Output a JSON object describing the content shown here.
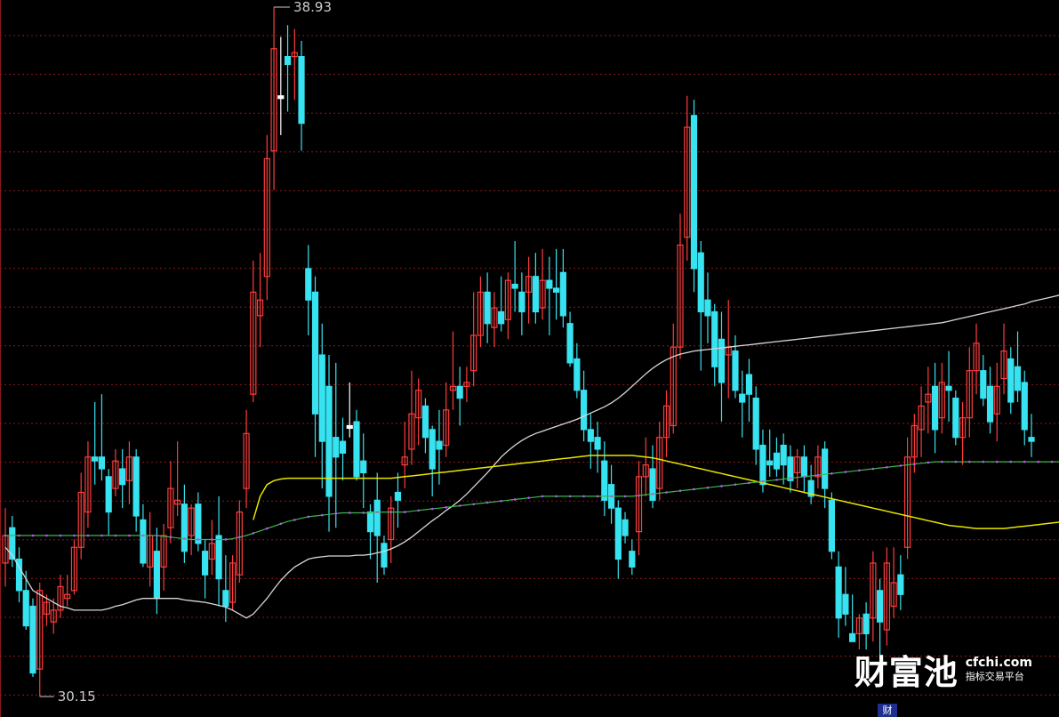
{
  "chart_data": {
    "type": "candlestick",
    "price_high_label": "38.93",
    "price_low_label": "30.15",
    "ylim": [
      29.8,
      39.2
    ],
    "grid": "horizontal dashed red",
    "colors": {
      "up": "#ff3c3c",
      "down": "#37e3f0",
      "doji": "#ffffff",
      "ma_white": "#d8d8d8",
      "ma_yellow": "#e6e600",
      "ma_green": "#39b84a",
      "ma_magenta": "#c050ff",
      "grid": "#8a1a1a"
    },
    "candles": [
      [
        31.85,
        32.55,
        31.55,
        32.2
      ],
      [
        32.3,
        32.45,
        31.8,
        31.9
      ],
      [
        31.9,
        32.05,
        31.35,
        31.5
      ],
      [
        31.5,
        31.75,
        31.0,
        31.05
      ],
      [
        31.3,
        31.4,
        30.4,
        30.45
      ],
      [
        30.5,
        31.6,
        30.15,
        31.5
      ],
      [
        31.2,
        31.45,
        31.05,
        31.35
      ],
      [
        31.1,
        31.4,
        30.95,
        31.25
      ],
      [
        31.25,
        31.7,
        31.15,
        31.55
      ],
      [
        31.4,
        31.7,
        31.3,
        31.45
      ],
      [
        31.5,
        32.15,
        31.45,
        32.05
      ],
      [
        32.05,
        33.0,
        31.9,
        32.75
      ],
      [
        32.5,
        33.4,
        32.3,
        33.2
      ],
      [
        33.2,
        33.9,
        32.85,
        33.15
      ],
      [
        33.2,
        34.0,
        32.9,
        33.05
      ],
      [
        32.95,
        33.05,
        32.2,
        32.5
      ],
      [
        32.8,
        33.3,
        32.7,
        33.15
      ],
      [
        33.05,
        33.3,
        32.55,
        32.85
      ],
      [
        32.9,
        33.4,
        32.6,
        33.2
      ],
      [
        33.2,
        33.3,
        32.25,
        32.45
      ],
      [
        32.4,
        32.6,
        31.8,
        31.85
      ],
      [
        31.8,
        32.5,
        31.55,
        32.2
      ],
      [
        32.0,
        32.3,
        31.2,
        31.4
      ],
      [
        31.8,
        32.35,
        31.5,
        32.2
      ],
      [
        32.3,
        33.15,
        32.1,
        32.8
      ],
      [
        32.6,
        33.4,
        32.45,
        32.65
      ],
      [
        32.6,
        32.85,
        31.85,
        32.0
      ],
      [
        32.2,
        32.6,
        31.95,
        32.55
      ],
      [
        32.6,
        32.75,
        32.0,
        32.1
      ],
      [
        32.0,
        32.15,
        31.4,
        31.7
      ],
      [
        31.9,
        32.4,
        31.7,
        32.1
      ],
      [
        32.2,
        32.7,
        31.3,
        31.65
      ],
      [
        31.5,
        31.95,
        31.1,
        31.3
      ],
      [
        31.35,
        31.95,
        31.25,
        31.85
      ],
      [
        31.7,
        32.65,
        31.6,
        32.5
      ],
      [
        32.8,
        33.8,
        32.55,
        33.5
      ],
      [
        34.0,
        35.7,
        33.9,
        35.3
      ],
      [
        35.0,
        35.8,
        34.6,
        35.2
      ],
      [
        35.5,
        37.3,
        35.2,
        37.0
      ],
      [
        37.1,
        38.93,
        36.6,
        38.4
      ],
      [
        37.8,
        38.55,
        37.3,
        37.8
      ],
      [
        38.3,
        38.7,
        37.6,
        38.2
      ],
      [
        38.3,
        38.65,
        37.75,
        38.35
      ],
      [
        38.3,
        38.5,
        37.1,
        37.45
      ],
      [
        35.6,
        35.9,
        34.75,
        35.2
      ],
      [
        35.3,
        35.5,
        33.2,
        33.75
      ],
      [
        34.5,
        34.9,
        32.8,
        33.4
      ],
      [
        34.1,
        34.5,
        32.25,
        32.7
      ],
      [
        33.45,
        34.4,
        32.3,
        33.2
      ],
      [
        33.4,
        33.7,
        32.9,
        33.25
      ],
      [
        33.6,
        34.15,
        33.45,
        33.6
      ],
      [
        33.65,
        33.8,
        32.9,
        32.95
      ],
      [
        33.15,
        33.5,
        32.55,
        33.0
      ],
      [
        32.5,
        32.6,
        31.9,
        32.25
      ],
      [
        32.65,
        33.0,
        31.6,
        32.2
      ],
      [
        32.1,
        32.2,
        31.7,
        31.8
      ],
      [
        32.15,
        32.7,
        31.85,
        32.55
      ],
      [
        32.75,
        33.0,
        32.3,
        32.65
      ],
      [
        33.1,
        33.65,
        32.8,
        33.2
      ],
      [
        33.3,
        34.3,
        33.1,
        33.75
      ],
      [
        33.7,
        34.2,
        33.35,
        34.05
      ],
      [
        33.85,
        33.95,
        33.25,
        33.45
      ],
      [
        33.55,
        33.6,
        32.7,
        33.05
      ],
      [
        33.4,
        33.8,
        32.85,
        33.3
      ],
      [
        33.35,
        34.15,
        33.2,
        33.8
      ],
      [
        34.05,
        34.8,
        33.8,
        34.1
      ],
      [
        34.1,
        34.35,
        33.6,
        33.95
      ],
      [
        34.1,
        34.35,
        33.9,
        34.15
      ],
      [
        34.3,
        35.3,
        34.1,
        34.75
      ],
      [
        34.75,
        35.5,
        34.6,
        35.3
      ],
      [
        35.3,
        35.55,
        34.65,
        34.9
      ],
      [
        34.85,
        35.3,
        34.6,
        35.1
      ],
      [
        35.05,
        35.5,
        34.8,
        34.9
      ],
      [
        34.95,
        35.55,
        34.7,
        35.45
      ],
      [
        35.4,
        35.95,
        35.05,
        35.35
      ],
      [
        35.3,
        35.55,
        34.75,
        35.05
      ],
      [
        35.3,
        35.75,
        34.9,
        35.5
      ],
      [
        35.5,
        35.8,
        34.9,
        35.05
      ],
      [
        35.1,
        35.85,
        34.95,
        35.45
      ],
      [
        35.45,
        35.75,
        34.75,
        35.35
      ],
      [
        35.35,
        35.85,
        34.95,
        35.3
      ],
      [
        35.55,
        35.85,
        34.85,
        35.0
      ],
      [
        34.9,
        35.05,
        34.35,
        34.4
      ],
      [
        34.45,
        34.65,
        33.95,
        34.05
      ],
      [
        34.05,
        34.3,
        33.4,
        33.55
      ],
      [
        33.55,
        33.75,
        33.05,
        33.4
      ],
      [
        33.45,
        33.65,
        33.0,
        33.3
      ],
      [
        33.15,
        33.4,
        32.45,
        32.65
      ],
      [
        32.85,
        33.1,
        32.35,
        32.55
      ],
      [
        32.55,
        32.65,
        31.65,
        31.9
      ],
      [
        32.4,
        32.5,
        32.1,
        32.2
      ],
      [
        32.0,
        32.15,
        31.7,
        31.8
      ],
      [
        32.25,
        33.15,
        31.95,
        32.95
      ],
      [
        32.95,
        33.45,
        32.7,
        33.1
      ],
      [
        33.05,
        33.35,
        32.55,
        32.65
      ],
      [
        32.8,
        33.65,
        32.65,
        33.45
      ],
      [
        33.45,
        34.05,
        33.2,
        33.85
      ],
      [
        33.6,
        34.9,
        33.5,
        34.6
      ],
      [
        34.6,
        36.3,
        34.45,
        35.9
      ],
      [
        36.0,
        37.8,
        35.7,
        37.4
      ],
      [
        37.55,
        37.75,
        35.3,
        35.6
      ],
      [
        35.8,
        35.95,
        34.3,
        35.05
      ],
      [
        35.2,
        35.55,
        34.65,
        35.0
      ],
      [
        35.05,
        35.15,
        34.1,
        34.35
      ],
      [
        34.7,
        35.05,
        33.65,
        34.15
      ],
      [
        34.5,
        35.2,
        33.95,
        34.6
      ],
      [
        34.55,
        34.75,
        33.95,
        34.05
      ],
      [
        34.0,
        34.3,
        33.45,
        33.9
      ],
      [
        34.25,
        34.45,
        33.65,
        34.0
      ],
      [
        33.95,
        34.1,
        33.1,
        33.3
      ],
      [
        33.35,
        33.55,
        32.75,
        32.85
      ],
      [
        33.15,
        33.55,
        32.95,
        33.1
      ],
      [
        33.25,
        33.45,
        32.95,
        33.05
      ],
      [
        33.35,
        33.5,
        32.85,
        33.1
      ],
      [
        33.2,
        33.35,
        32.75,
        32.9
      ],
      [
        33.0,
        33.3,
        32.8,
        33.2
      ],
      [
        33.2,
        33.35,
        32.75,
        32.95
      ],
      [
        32.9,
        33.1,
        32.6,
        32.7
      ],
      [
        32.95,
        33.35,
        32.8,
        33.2
      ],
      [
        33.3,
        33.4,
        32.55,
        32.8
      ],
      [
        32.65,
        32.75,
        31.9,
        32.0
      ],
      [
        31.8,
        32.0,
        30.9,
        31.15
      ],
      [
        31.45,
        31.8,
        31.05,
        31.2
      ],
      [
        30.95,
        31.45,
        30.9,
        30.85
      ],
      [
        30.95,
        31.2,
        30.75,
        31.15
      ],
      [
        31.2,
        31.35,
        30.75,
        30.95
      ],
      [
        31.15,
        32.0,
        30.85,
        31.85
      ],
      [
        31.5,
        31.65,
        30.65,
        31.1
      ],
      [
        31.0,
        32.05,
        30.8,
        31.85
      ],
      [
        31.3,
        32.05,
        31.15,
        31.6
      ],
      [
        31.7,
        31.95,
        31.25,
        31.45
      ],
      [
        32.05,
        33.45,
        31.9,
        33.2
      ],
      [
        33.2,
        33.75,
        33.0,
        33.6
      ],
      [
        33.55,
        34.1,
        33.2,
        33.85
      ],
      [
        33.9,
        34.35,
        33.5,
        34.0
      ],
      [
        34.1,
        34.4,
        33.25,
        33.55
      ],
      [
        33.7,
        34.4,
        33.5,
        34.15
      ],
      [
        34.1,
        34.55,
        33.65,
        34.05
      ],
      [
        33.95,
        34.05,
        33.35,
        33.45
      ],
      [
        33.45,
        33.9,
        33.1,
        33.7
      ],
      [
        33.7,
        34.6,
        33.45,
        34.3
      ],
      [
        34.3,
        34.9,
        34.0,
        34.65
      ],
      [
        34.3,
        34.5,
        33.85,
        33.95
      ],
      [
        34.1,
        34.35,
        33.5,
        33.65
      ],
      [
        33.75,
        34.4,
        33.4,
        34.1
      ],
      [
        34.2,
        34.9,
        34.0,
        34.55
      ],
      [
        34.45,
        34.6,
        33.75,
        33.9
      ],
      [
        34.35,
        34.8,
        33.9,
        34.05
      ],
      [
        34.15,
        34.3,
        33.35,
        33.55
      ],
      [
        33.45,
        33.75,
        33.2,
        33.4
      ]
    ],
    "ma_white": [
      32.05,
      31.95,
      31.8,
      31.65,
      31.5,
      31.45,
      31.4,
      31.35,
      31.3,
      31.28,
      31.25,
      31.25,
      31.25,
      31.25,
      31.25,
      31.27,
      31.3,
      31.32,
      31.35,
      31.38,
      31.4,
      31.4,
      31.4,
      31.4,
      31.4,
      31.4,
      31.38,
      31.37,
      31.36,
      31.35,
      31.33,
      31.31,
      31.29,
      31.25,
      31.2,
      31.15,
      31.2,
      31.3,
      31.4,
      31.52,
      31.63,
      31.72,
      31.8,
      31.85,
      31.9,
      31.92,
      31.93,
      31.94,
      31.94,
      31.94,
      31.94,
      31.95,
      31.95,
      31.96,
      31.98,
      32.0,
      32.03,
      32.07,
      32.12,
      32.18,
      32.25,
      32.32,
      32.39,
      32.45,
      32.52,
      32.58,
      32.65,
      32.73,
      32.82,
      32.91,
      33.0,
      33.1,
      33.2,
      33.28,
      33.35,
      33.41,
      33.46,
      33.5,
      33.53,
      33.56,
      33.59,
      33.62,
      33.65,
      33.68,
      33.72,
      33.76,
      33.8,
      33.84,
      33.89,
      33.95,
      34.02,
      34.1,
      34.18,
      34.26,
      34.33,
      34.39,
      34.44,
      34.48,
      34.51,
      34.53,
      34.55,
      34.56,
      34.57,
      34.58,
      34.59,
      34.6,
      34.61,
      34.62,
      34.63,
      34.64,
      34.65,
      34.66,
      34.67,
      34.68,
      34.69,
      34.7,
      34.71,
      34.72,
      34.73,
      34.74,
      34.75,
      34.76,
      34.77,
      34.78,
      34.79,
      34.8,
      34.81,
      34.82,
      34.83,
      34.84,
      34.85,
      34.86,
      34.87,
      34.88,
      34.89,
      34.9,
      34.91,
      34.93,
      34.95,
      34.97,
      34.99,
      35.01,
      35.03,
      35.05,
      35.07,
      35.09,
      35.11,
      35.13,
      35.15,
      35.18,
      35.2,
      35.22,
      35.24,
      35.26,
      35.28,
      35.3,
      35.32
    ],
    "ma_yellow_start": 36,
    "ma_yellow": [
      32.4,
      32.7,
      32.85,
      32.9,
      32.92,
      32.93,
      32.93,
      32.93,
      32.93,
      32.93,
      32.93,
      32.93,
      32.93,
      32.93,
      32.93,
      32.93,
      32.93,
      32.93,
      32.93,
      32.93,
      32.93,
      32.94,
      32.95,
      32.96,
      32.97,
      32.98,
      32.99,
      33.0,
      33.01,
      33.02,
      33.03,
      33.04,
      33.05,
      33.06,
      33.07,
      33.08,
      33.09,
      33.1,
      33.11,
      33.12,
      33.13,
      33.14,
      33.15,
      33.16,
      33.17,
      33.18,
      33.19,
      33.2,
      33.21,
      33.22,
      33.22,
      33.22,
      33.22,
      33.22,
      33.22,
      33.22,
      33.21,
      33.2,
      33.19,
      33.17,
      33.15,
      33.13,
      33.11,
      33.09,
      33.07,
      33.05,
      33.03,
      33.01,
      32.99,
      32.97,
      32.95,
      32.93,
      32.91,
      32.89,
      32.87,
      32.85,
      32.83,
      32.81,
      32.79,
      32.77,
      32.75,
      32.73,
      32.71,
      32.69,
      32.67,
      32.65,
      32.63,
      32.61,
      32.59,
      32.57,
      32.55,
      32.53,
      32.51,
      32.49,
      32.47,
      32.45,
      32.43,
      32.41,
      32.39,
      32.37,
      32.35,
      32.33,
      32.32,
      32.31,
      32.3,
      32.29,
      32.29,
      32.29,
      32.29,
      32.29,
      32.3,
      32.31,
      32.32,
      32.33,
      32.34,
      32.35,
      32.36,
      32.37
    ],
    "ma_green": [
      32.2,
      32.2,
      32.2,
      32.2,
      32.2,
      32.2,
      32.2,
      32.2,
      32.2,
      32.2,
      32.2,
      32.2,
      32.2,
      32.2,
      32.2,
      32.2,
      32.2,
      32.2,
      32.2,
      32.2,
      32.2,
      32.2,
      32.2,
      32.19,
      32.18,
      32.17,
      32.16,
      32.15,
      32.15,
      32.15,
      32.15,
      32.15,
      32.15,
      32.16,
      32.18,
      32.2,
      32.23,
      32.26,
      32.29,
      32.32,
      32.35,
      32.38,
      32.4,
      32.42,
      32.44,
      32.45,
      32.46,
      32.47,
      32.48,
      32.49,
      32.49,
      32.49,
      32.49,
      32.49,
      32.5,
      32.5,
      32.5,
      32.5,
      32.5,
      32.51,
      32.52,
      32.53,
      32.54,
      32.55,
      32.56,
      32.57,
      32.58,
      32.59,
      32.6,
      32.61,
      32.62,
      32.63,
      32.64,
      32.65,
      32.66,
      32.67,
      32.68,
      32.69,
      32.7,
      32.7,
      32.7,
      32.7,
      32.7,
      32.7,
      32.7,
      32.7,
      32.7,
      32.7,
      32.7,
      32.7,
      32.7,
      32.7,
      32.71,
      32.72,
      32.73,
      32.74,
      32.75,
      32.76,
      32.77,
      32.78,
      32.79,
      32.8,
      32.81,
      32.82,
      32.83,
      32.84,
      32.85,
      32.86,
      32.87,
      32.88,
      32.89,
      32.9,
      32.91,
      32.92,
      32.93,
      32.94,
      32.95,
      32.96,
      32.97,
      32.98,
      32.99,
      33.0,
      33.01,
      33.02,
      33.03,
      33.04,
      33.05,
      33.06,
      33.07,
      33.08,
      33.09,
      33.1,
      33.11,
      33.12,
      33.13,
      33.14,
      33.14,
      33.14,
      33.14,
      33.14,
      33.14,
      33.14,
      33.14,
      33.14,
      33.14,
      33.14,
      33.14,
      33.14,
      33.14,
      33.14,
      33.14,
      33.14,
      33.14,
      33.14,
      33.14,
      33.14
    ]
  },
  "watermark": {
    "cn": "财富池",
    "domain": "cfchi.com",
    "sub": "指标交易平台"
  },
  "flag": "财"
}
